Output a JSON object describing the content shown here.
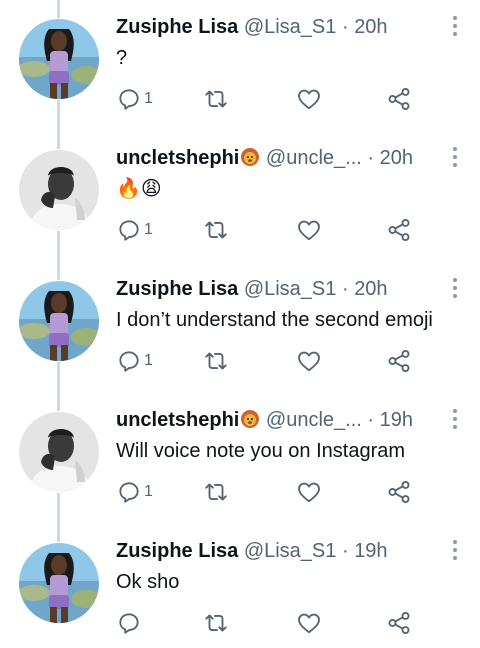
{
  "tweets": [
    {
      "name": "Zusiphe Lisa",
      "handle": "@Lisa_S1",
      "sep": "·",
      "time": "20h",
      "text": "?",
      "replies": "1",
      "avatar": "zusiphe",
      "badge": false
    },
    {
      "name": "uncletshephi",
      "handle": "@uncle_...",
      "sep": "·",
      "time": "20h",
      "text": "🔥😩",
      "replies": "1",
      "avatar": "uncle",
      "badge": true
    },
    {
      "name": "Zusiphe Lisa",
      "handle": "@Lisa_S1",
      "sep": "·",
      "time": "20h",
      "text": "I don’t understand the second emoji",
      "replies": "1",
      "avatar": "zusiphe",
      "badge": false
    },
    {
      "name": "uncletshephi",
      "handle": "@uncle_...",
      "sep": "·",
      "time": "19h",
      "text": "Will voice note you on Instagram",
      "replies": "1",
      "avatar": "uncle",
      "badge": true
    },
    {
      "name": "Zusiphe Lisa",
      "handle": "@Lisa_S1",
      "sep": "·",
      "time": "19h",
      "text": "Ok sho",
      "replies": "",
      "avatar": "zusiphe",
      "badge": false
    }
  ],
  "icons": {
    "reply": "reply-icon",
    "retweet": "retweet-icon",
    "like": "heart-icon",
    "share": "share-icon",
    "more": "more-vertical-icon",
    "badge": "lion-emoji-icon"
  },
  "colors": {
    "text": "#0f1419",
    "muted": "#536471",
    "thread_line": "#cfd9de"
  }
}
